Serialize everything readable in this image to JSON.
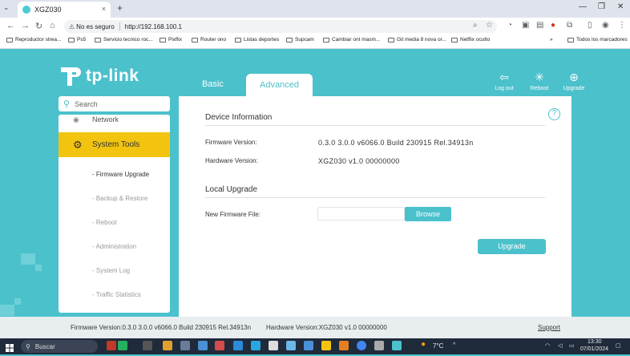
{
  "browser": {
    "tab_title": "XGZ030",
    "tab_close": "×",
    "new_tab": "+",
    "address_warning": "No es seguro",
    "url": "http://192.168.100.1",
    "bookmarks": [
      "Reproductor strea...",
      "Ps5",
      "Servicio tecnico roc...",
      "Pixflix",
      "Router ono",
      "Listas deportes",
      "Supcam",
      "Cambiar ont masm...",
      "Git media 8 nova or...",
      "Netflix oculto"
    ],
    "bookmarks_more": "»",
    "all_bookmarks": "Todos los marcadores"
  },
  "router": {
    "brand": "tp-link",
    "tabs": {
      "basic": "Basic",
      "advanced": "Advanced"
    },
    "top_actions": {
      "logout": "Log out",
      "reboot": "Reboot",
      "upgrade": "Upgrade"
    },
    "search_placeholder": "Search",
    "sidebar": {
      "network": "Network",
      "system_tools": "System Tools",
      "items": [
        "- Firmware Upgrade",
        "- Backup & Restore",
        "- Reboot",
        "- Administration",
        "- System Log",
        "- Traffic Statistics"
      ]
    },
    "device_info": {
      "title": "Device Information",
      "firmware_label": "Firmware Version:",
      "firmware_value": "0.3.0 3.0.0 v6066.0 Build 230915 Rel.34913n",
      "hardware_label": "Hardware Version:",
      "hardware_value": "XGZ030 v1.0 00000000"
    },
    "local_upgrade": {
      "title": "Local Upgrade",
      "file_label": "New Firmware File:",
      "browse_button": "Browse",
      "upgrade_button": "Upgrade"
    },
    "help": "?",
    "footer": {
      "firmware": "Firmware Version:0.3.0 3.0.0 v6066.0 Build 230915 Rel.34913n",
      "hardware": "Hardware Version:XGZ030 v1.0 00000000",
      "support": "Support"
    }
  },
  "taskbar": {
    "search": "Buscar",
    "temp": "7°C",
    "time": "13:30",
    "date": "07/01/2024"
  },
  "colors": {
    "teal": "#4bc1cc",
    "yellow": "#f2c40f"
  }
}
